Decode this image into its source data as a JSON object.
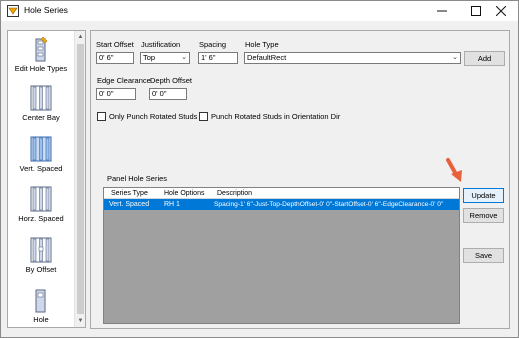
{
  "window": {
    "title": "Hole Series",
    "minimize_glyph": "—",
    "maximize_glyph": "☐",
    "close_glyph": "✕"
  },
  "nav": {
    "items": [
      {
        "label": "Edit Hole Types",
        "icon": "edit-hole-types-icon"
      },
      {
        "label": "Center Bay",
        "icon": "center-bay-icon"
      },
      {
        "label": "Vert. Spaced",
        "icon": "vert-spaced-icon",
        "selected": true
      },
      {
        "label": "Horz. Spaced",
        "icon": "horz-spaced-icon"
      },
      {
        "label": "By Offset",
        "icon": "by-offset-icon"
      },
      {
        "label": "Hole",
        "icon": "hole-icon"
      }
    ],
    "scroll_up": "▲",
    "scroll_down": "▼"
  },
  "form": {
    "start_offset": {
      "label": "Start Offset",
      "value": "0' 6\""
    },
    "justification": {
      "label": "Justification",
      "value": "Top"
    },
    "spacing": {
      "label": "Spacing",
      "value": "1' 6\""
    },
    "hole_type": {
      "label": "Hole Type",
      "value": "DefaultRect"
    },
    "add_label": "Add",
    "edge_clearance": {
      "label": "Edge Clearance",
      "value": "0' 0\""
    },
    "depth_offset": {
      "label": "Depth Offset",
      "value": "0' 0\""
    },
    "only_punch_rotated": {
      "label": "Only Punch Rotated Studs",
      "checked": false
    },
    "punch_rotated_orientation": {
      "label": "Punch Rotated Studs in Orientation Dir",
      "checked": false
    }
  },
  "panel_hole_series": {
    "label": "Panel Hole Series",
    "columns": [
      "Series Type",
      "Hole Options",
      "Description"
    ],
    "rows": [
      {
        "series_type": "Vert. Spaced",
        "hole_options": "RH 1",
        "description": "Spacing-1' 6\"-Just-Top-DepthOffset-0' 0\"-StartOffset-0' 6\"-EdgeClearance-0' 0\"",
        "selected": true
      }
    ]
  },
  "actions": {
    "update_label": "Update",
    "remove_label": "Remove",
    "save_label": "Save"
  },
  "colors": {
    "selection": "#0078d7",
    "annotation_arrow": "#e8603c"
  }
}
